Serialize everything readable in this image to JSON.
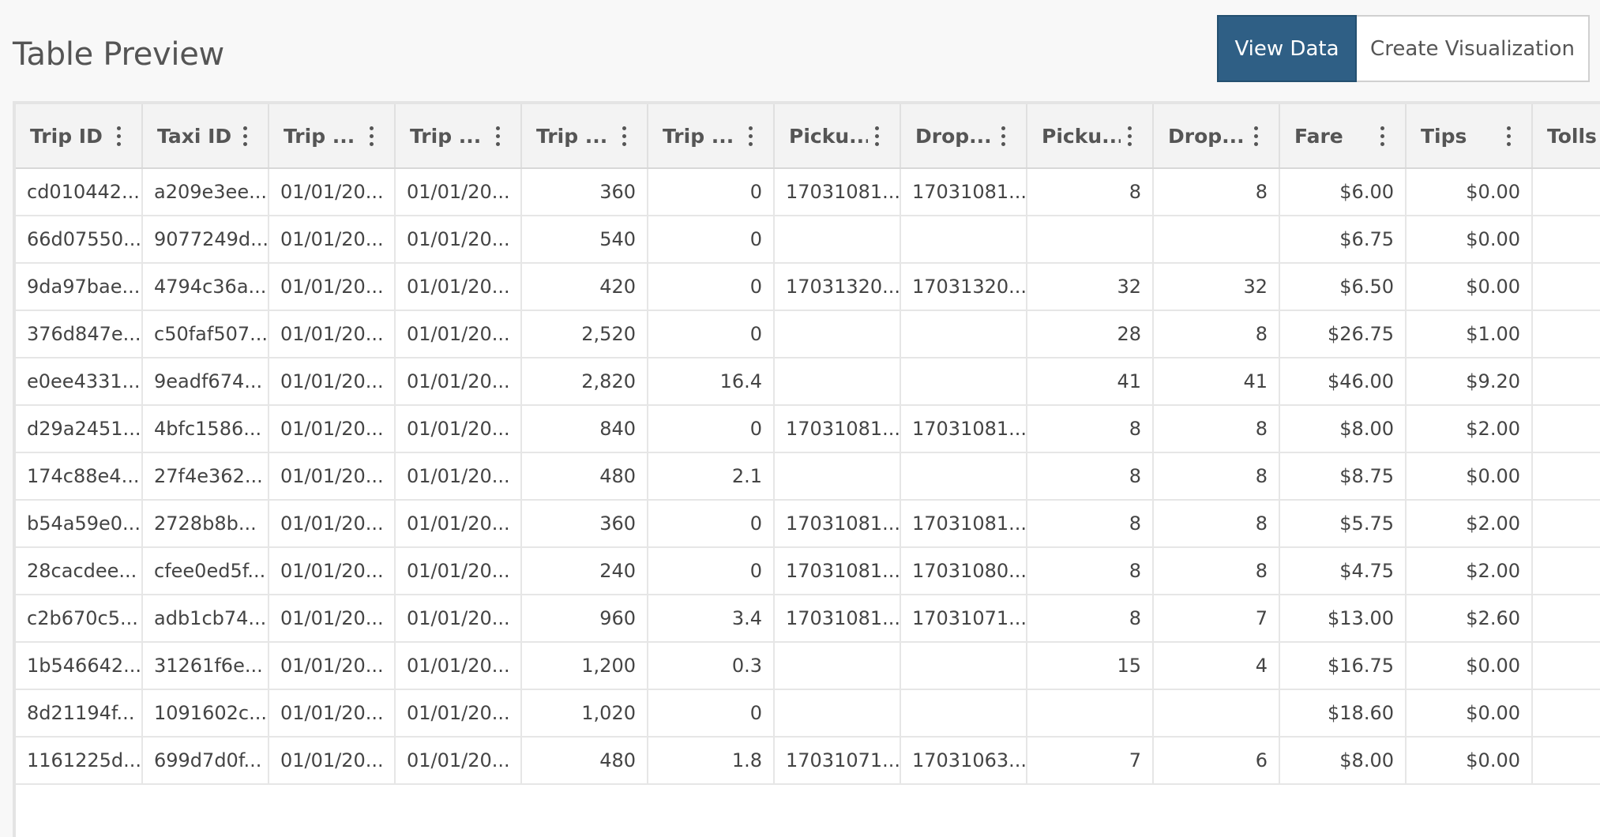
{
  "page": {
    "title": "Table Preview"
  },
  "toolbar": {
    "view_data_label": "View Data",
    "create_visualization_label": "Create Visualization"
  },
  "colors": {
    "primary_button": "#2f5f85",
    "header_bg": "#f3f3f3"
  },
  "table": {
    "columns": [
      {
        "label": "Trip ID",
        "align": "txt"
      },
      {
        "label": "Taxi ID",
        "align": "txt"
      },
      {
        "label": "Trip ...",
        "align": "txt"
      },
      {
        "label": "Trip ...",
        "align": "txt"
      },
      {
        "label": "Trip ...",
        "align": "num"
      },
      {
        "label": "Trip ...",
        "align": "num"
      },
      {
        "label": "Picku...",
        "align": "txt"
      },
      {
        "label": "Drop...",
        "align": "txt"
      },
      {
        "label": "Picku...",
        "align": "num"
      },
      {
        "label": "Drop...",
        "align": "num"
      },
      {
        "label": "Fare",
        "align": "num"
      },
      {
        "label": "Tips",
        "align": "num"
      },
      {
        "label": "Tolls",
        "align": "num"
      },
      {
        "label": "",
        "align": "num"
      }
    ],
    "rows": [
      [
        "cd010442...",
        "a209e3ee...",
        "01/01/20...",
        "01/01/20...",
        "360",
        "0",
        "17031081...",
        "17031081...",
        "8",
        "8",
        "$6.00",
        "$0.00",
        "",
        ""
      ],
      [
        "66d07550...",
        "9077249d...",
        "01/01/20...",
        "01/01/20...",
        "540",
        "0",
        "",
        "",
        "",
        "",
        "$6.75",
        "$0.00",
        "",
        ""
      ],
      [
        "9da97bae...",
        "4794c36a...",
        "01/01/20...",
        "01/01/20...",
        "420",
        "0",
        "17031320...",
        "17031320...",
        "32",
        "32",
        "$6.50",
        "$0.00",
        "",
        ""
      ],
      [
        "376d847e...",
        "c50faf507...",
        "01/01/20...",
        "01/01/20...",
        "2,520",
        "0",
        "",
        "",
        "28",
        "8",
        "$26.75",
        "$1.00",
        "",
        ""
      ],
      [
        "e0ee4331...",
        "9eadf674...",
        "01/01/20...",
        "01/01/20...",
        "2,820",
        "16.4",
        "",
        "",
        "41",
        "41",
        "$46.00",
        "$9.20",
        "",
        ""
      ],
      [
        "d29a2451...",
        "4bfc1586...",
        "01/01/20...",
        "01/01/20...",
        "840",
        "0",
        "17031081...",
        "17031081...",
        "8",
        "8",
        "$8.00",
        "$2.00",
        "",
        ""
      ],
      [
        "174c88e4...",
        "27f4e362...",
        "01/01/20...",
        "01/01/20...",
        "480",
        "2.1",
        "",
        "",
        "8",
        "8",
        "$8.75",
        "$0.00",
        "",
        ""
      ],
      [
        "b54a59e0...",
        "2728b8b...",
        "01/01/20...",
        "01/01/20...",
        "360",
        "0",
        "17031081...",
        "17031081...",
        "8",
        "8",
        "$5.75",
        "$2.00",
        "",
        ""
      ],
      [
        "28cacdee...",
        "cfee0ed5f...",
        "01/01/20...",
        "01/01/20...",
        "240",
        "0",
        "17031081...",
        "17031080...",
        "8",
        "8",
        "$4.75",
        "$2.00",
        "",
        ""
      ],
      [
        "c2b670c5...",
        "adb1cb74...",
        "01/01/20...",
        "01/01/20...",
        "960",
        "3.4",
        "17031081...",
        "17031071...",
        "8",
        "7",
        "$13.00",
        "$2.60",
        "",
        ""
      ],
      [
        "1b546642...",
        "31261f6e...",
        "01/01/20...",
        "01/01/20...",
        "1,200",
        "0.3",
        "",
        "",
        "15",
        "4",
        "$16.75",
        "$0.00",
        "",
        ""
      ],
      [
        "8d21194f...",
        "1091602c...",
        "01/01/20...",
        "01/01/20...",
        "1,020",
        "0",
        "",
        "",
        "",
        "",
        "$18.60",
        "$0.00",
        "",
        ""
      ],
      [
        "1161225d...",
        "699d7d0f...",
        "01/01/20...",
        "01/01/20...",
        "480",
        "1.8",
        "17031071...",
        "17031063...",
        "7",
        "6",
        "$8.00",
        "$0.00",
        "",
        ""
      ]
    ]
  }
}
